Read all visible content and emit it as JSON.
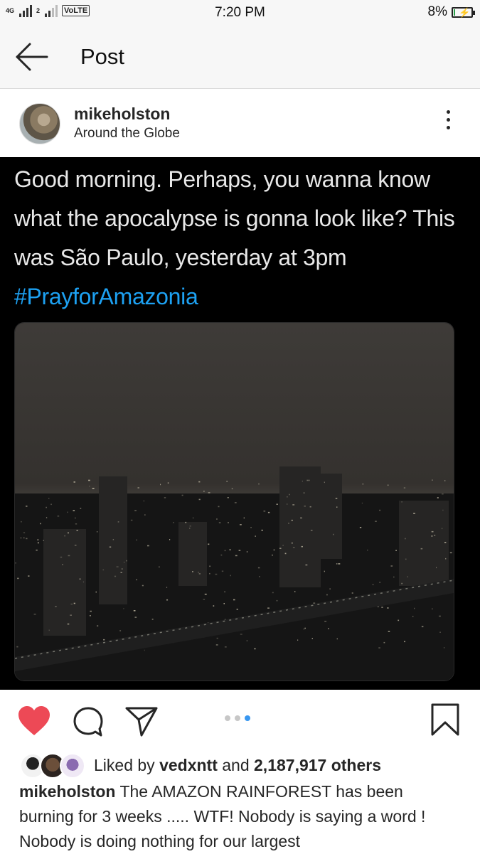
{
  "status_bar": {
    "network_1": "4G",
    "network_2": "2",
    "volte": "VoLTE",
    "time": "7:20 PM",
    "battery_percent": "8%",
    "battery_level": 0.08,
    "battery_color": "#2aa24a"
  },
  "header": {
    "title": "Post",
    "back_icon": "arrow-left-icon"
  },
  "post": {
    "username": "mikeholston",
    "location": "Around the Globe",
    "more_icon": "vertical-ellipsis-icon",
    "media": {
      "tweet_text": "Good morning. Perhaps, you wanna know what the apocalypse is gonna look like? This was São Paulo, yesterday at 3pm ",
      "tweet_hashtag": "#PrayforAmazonia",
      "hashtag_color": "#1da1f2",
      "photo_icon": "dark-city-photo"
    },
    "actions": {
      "like_icon": "heart-icon",
      "like_color": "#ed4956",
      "comment_icon": "comment-icon",
      "share_icon": "send-icon",
      "save_icon": "bookmark-icon",
      "carousel_dots": 3,
      "carousel_active_index": 2
    },
    "likes": {
      "prefix": "Liked by",
      "user": "vedxntt",
      "joiner": "and",
      "others": "2,187,917 others"
    },
    "caption": {
      "username": "mikeholston",
      "text": "The AMAZON RAINFOREST has been burning for 3 weeks ..... WTF! Nobody is saying a word ! Nobody is doing nothing for our largest"
    }
  }
}
